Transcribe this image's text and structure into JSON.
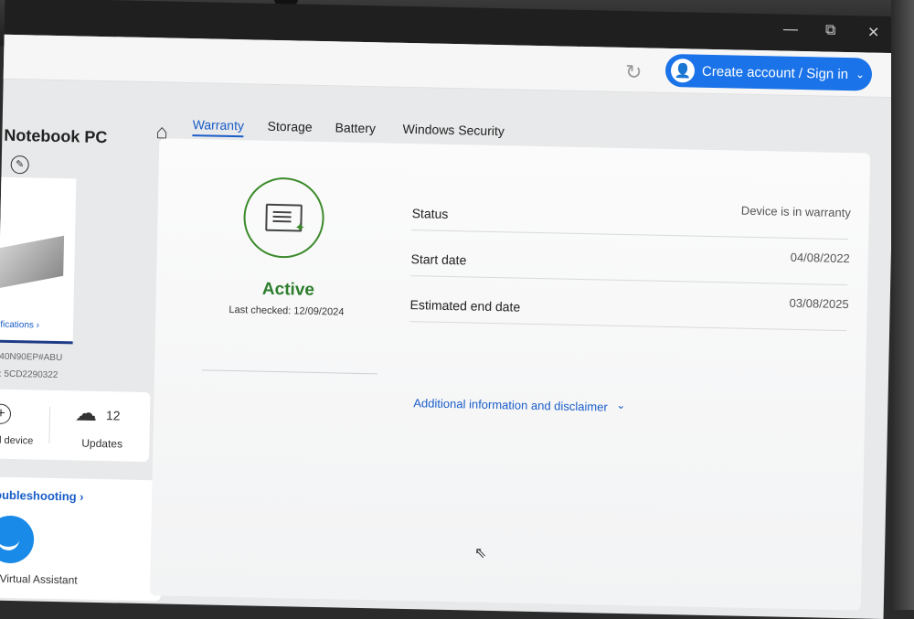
{
  "window": {
    "minimize": "—",
    "restore": "⧉",
    "close": "✕"
  },
  "header": {
    "refresh_icon": "refresh-icon",
    "signin_label": "Create account / Sign in"
  },
  "device": {
    "title": "Notebook PC",
    "specs_link": "ifications ›",
    "product_number": "40N90EP#ABU",
    "serial_number": ": 5CD2290322"
  },
  "actions": {
    "add_device_label": "d device",
    "updates_count": "12",
    "updates_label": "Updates"
  },
  "support": {
    "troubleshooting_link": "oubleshooting ›",
    "virtual_assistant_label": "r Virtual Assistant"
  },
  "tabs": [
    {
      "label": "Warranty",
      "active": true
    },
    {
      "label": "Storage",
      "active": false
    },
    {
      "label": "Battery",
      "active": false
    },
    {
      "label": "Windows Security",
      "active": false
    }
  ],
  "warranty": {
    "status_label": "Active",
    "last_checked": "Last checked: 12/09/2024",
    "rows": [
      {
        "label": "Status",
        "value": "Device is in warranty"
      },
      {
        "label": "Start date",
        "value": "04/08/2022"
      },
      {
        "label": "Estimated end date",
        "value": "03/08/2025"
      }
    ],
    "additional_link": "Additional information and disclaimer"
  },
  "colors": {
    "accent": "#1a73e8",
    "active_green": "#2d7d2d",
    "link_blue": "#1a5dc8"
  }
}
